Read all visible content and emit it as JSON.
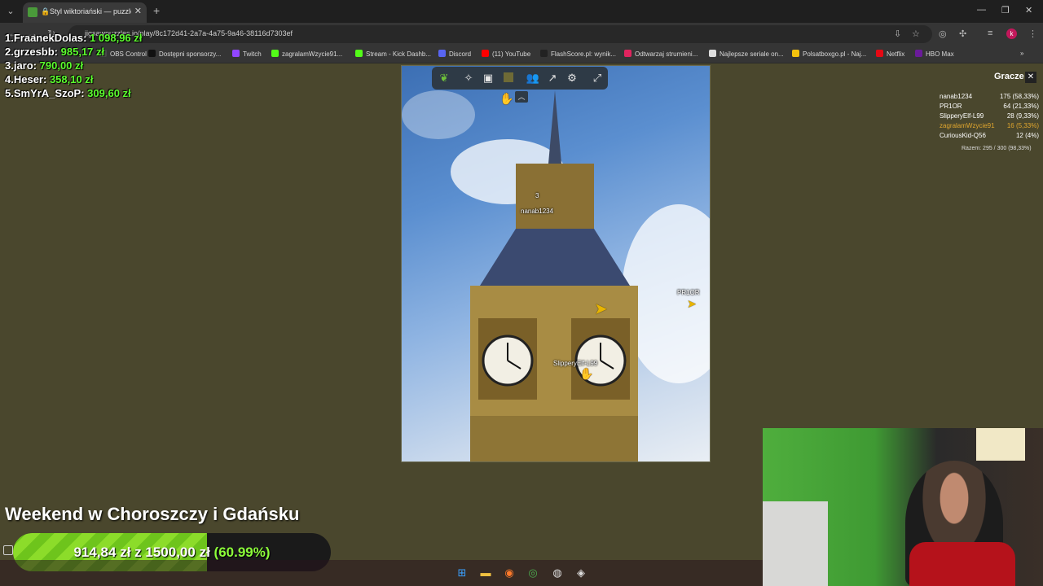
{
  "browser": {
    "tab_title": "Styl wiktoriański — puzzle o",
    "url": "jigsawpuzzles.io/play/8c172d41-2a7a-4a75-9a46-38116d7303ef",
    "bookmarks": [
      {
        "label": "OBS Control",
        "color": "#4a4a4a"
      },
      {
        "label": "Dostępni sponsorzy...",
        "color": "#111111"
      },
      {
        "label": "Twitch",
        "color": "#9146ff"
      },
      {
        "label": "zagralamWzycie91...",
        "color": "#53fc18"
      },
      {
        "label": "Stream - Kick Dashb...",
        "color": "#53fc18"
      },
      {
        "label": "Discord",
        "color": "#5865f2"
      },
      {
        "label": "(11) YouTube",
        "color": "#ff0000"
      },
      {
        "label": "FlashScore.pl: wynik...",
        "color": "#222222"
      },
      {
        "label": "Odtwarzaj strumieni...",
        "color": "#e0245e"
      },
      {
        "label": "Najlepsze seriale on...",
        "color": "#dddddd"
      },
      {
        "label": "Polsatboxgo.pl - Naj...",
        "color": "#f4c20d"
      },
      {
        "label": "Netflix",
        "color": "#e50914"
      },
      {
        "label": "HBO Max",
        "color": "#6a1b9a"
      }
    ],
    "profile_initial": "k"
  },
  "leaderboard": [
    {
      "name": "1.FraanekDolas:",
      "amount": "1 098,96 zł"
    },
    {
      "name": "2.grzesbb:",
      "amount": "985,17 zł"
    },
    {
      "name": "3.jaro:",
      "amount": "790,00 zł"
    },
    {
      "name": "4.Heser:",
      "amount": "358,10 zł"
    },
    {
      "name": "5.SmYrA_SzoP:",
      "amount": "309,60 zł"
    }
  ],
  "puzzle": {
    "toolbar_icons": [
      "logo-icon",
      "puzzle-piece-icon",
      "image-icon",
      "background-color-icon",
      "players-icon",
      "share-icon",
      "settings-icon",
      "fullscreen-icon"
    ],
    "cursors": [
      {
        "label": "3",
        "name": "nanab1234"
      },
      {
        "label": "PR1OR"
      },
      {
        "label": "SlipperyElf-L99"
      }
    ]
  },
  "players": {
    "title": "Gracze",
    "list": [
      {
        "name": "nanab1234",
        "score": "175 (58,33%)",
        "highlight": false
      },
      {
        "name": "PR1OR",
        "score": "64 (21,33%)",
        "highlight": false
      },
      {
        "name": "SlipperyElf-L99",
        "score": "28 (9,33%)",
        "highlight": false
      },
      {
        "name": "zagralamWzycie91",
        "score": "16 (5,33%)",
        "highlight": true
      },
      {
        "name": "CuriousKid-Q56",
        "score": "12 (4%)",
        "highlight": false
      }
    ],
    "total": "Razem: 295 / 300 (98,33%)"
  },
  "goal": {
    "title": "Weekend w Choroszczy i Gdańsku",
    "current": "914,84 zł",
    "sep": "z",
    "target": "1500,00 zł",
    "percent_label": "(60.99%)",
    "progress": 0.6099
  },
  "colors": {
    "background": "#4a472d",
    "leader_amount": "#5cff2e",
    "goal_fill": "#7ed321"
  }
}
